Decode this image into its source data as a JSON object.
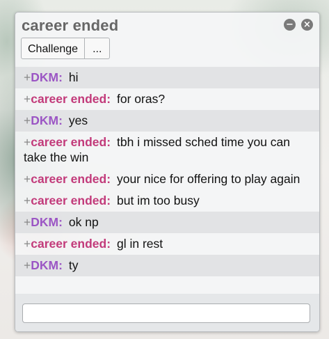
{
  "window": {
    "title": "career ended",
    "minimize_glyph": "−",
    "close_glyph": "×"
  },
  "tabs": [
    {
      "label": "Challenge"
    },
    {
      "label": "..."
    }
  ],
  "messages": [
    {
      "rank": "+",
      "user": "DKM",
      "text": "hi"
    },
    {
      "rank": "+",
      "user": "career ended",
      "text": "for oras?"
    },
    {
      "rank": "+",
      "user": "DKM",
      "text": "yes"
    },
    {
      "rank": "+",
      "user": "career ended",
      "text": "tbh i missed sched time you can take the win"
    },
    {
      "rank": "+",
      "user": "career ended",
      "text": "your nice for offering to play again"
    },
    {
      "rank": "+",
      "user": "career ended",
      "text": "but im too busy"
    },
    {
      "rank": "+",
      "user": "DKM",
      "text": "ok np"
    },
    {
      "rank": "+",
      "user": "career ended",
      "text": "gl in rest"
    },
    {
      "rank": "+",
      "user": "DKM",
      "text": "ty"
    }
  ],
  "composer": {
    "value": "",
    "placeholder": ""
  },
  "colors": {
    "dkm_name": "#9b55c4",
    "career_ended_name": "#c23a7a",
    "title_text": "#666666"
  }
}
